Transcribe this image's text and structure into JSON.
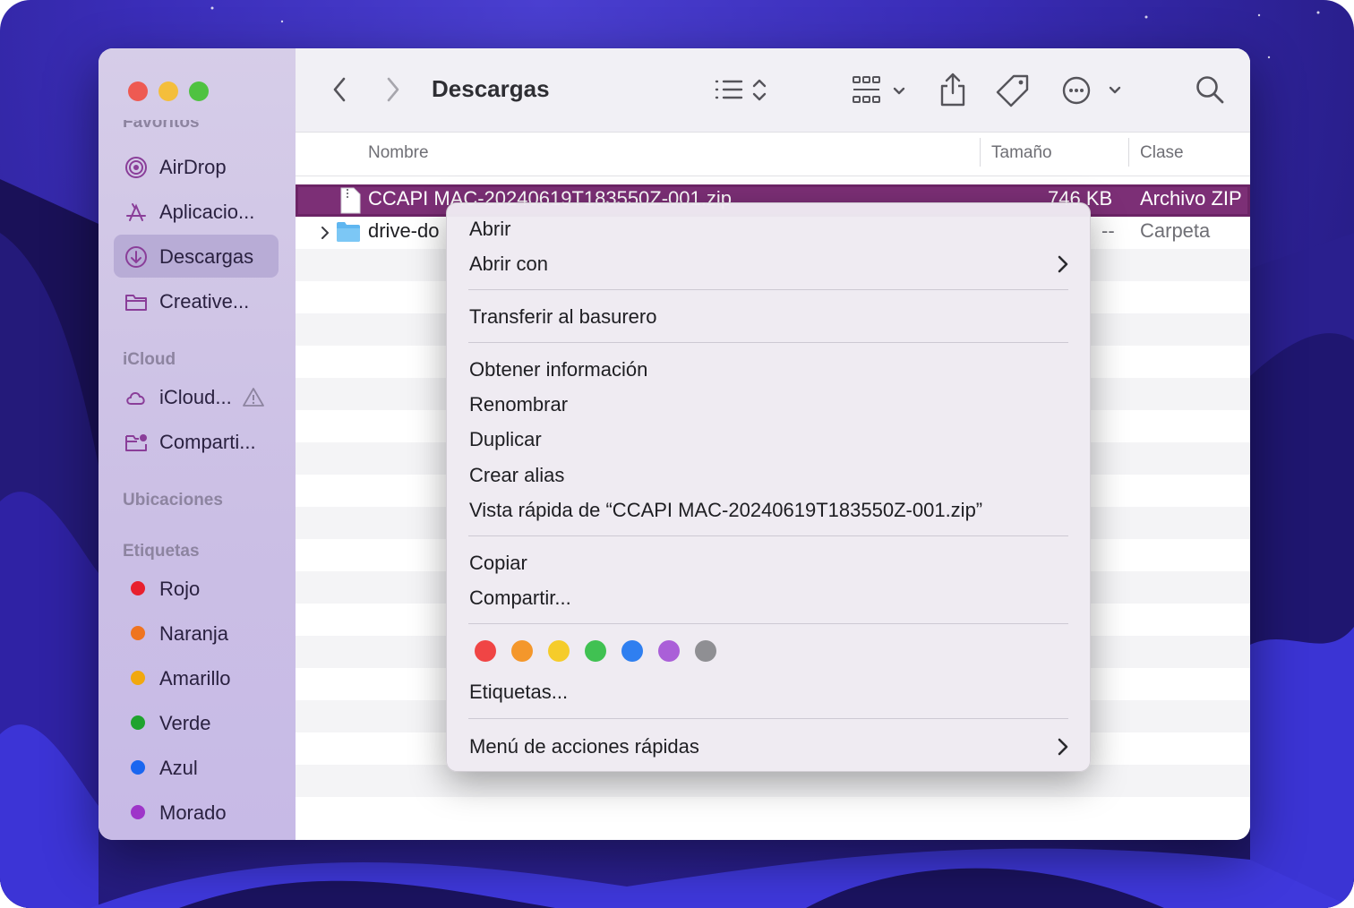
{
  "finder": {
    "title": "Descargas",
    "sidebar": {
      "favorites_title": "Favoritos",
      "favorites": [
        {
          "label": "AirDrop",
          "icon": "airdrop-icon"
        },
        {
          "label": "Aplicacio...",
          "icon": "applications-icon"
        },
        {
          "label": "Descargas",
          "icon": "downloads-icon",
          "selected": true
        },
        {
          "label": "Creative...",
          "icon": "folder-icon"
        }
      ],
      "icloud_title": "iCloud",
      "icloud": [
        {
          "label": "iCloud...",
          "icon": "icloud-icon",
          "warning_icon": "warning-icon"
        },
        {
          "label": "Comparti...",
          "icon": "shared-folder-icon"
        }
      ],
      "locations_title": "Ubicaciones",
      "tags_title": "Etiquetas",
      "tags": [
        {
          "label": "Rojo",
          "color": "#e8202e"
        },
        {
          "label": "Naranja",
          "color": "#ef7420"
        },
        {
          "label": "Amarillo",
          "color": "#f1a80f"
        },
        {
          "label": "Verde",
          "color": "#1fa32e"
        },
        {
          "label": "Azul",
          "color": "#1a66f0"
        },
        {
          "label": "Morado",
          "color": "#9e35c9"
        }
      ]
    },
    "columns": {
      "name": "Nombre",
      "size": "Tamaño",
      "kind": "Clase"
    },
    "files": [
      {
        "name": "CCAPI MAC-20240619T183550Z-001.zip",
        "size": "746 KB",
        "kind": "Archivo ZIP",
        "selected": true
      },
      {
        "name": "drive-do",
        "size": "--",
        "kind": "Carpeta"
      }
    ]
  },
  "context_menu": {
    "open": "Abrir",
    "open_with": "Abrir con",
    "trash": "Transferir al basurero",
    "get_info": "Obtener información",
    "rename": "Renombrar",
    "duplicate": "Duplicar",
    "make_alias": "Crear alias",
    "quick_look": "Vista rápida de “CCAPI MAC-20240619T183550Z-001.zip”",
    "copy": "Copiar",
    "share": "Compartir...",
    "tag_colors": [
      "#f04545",
      "#f4972b",
      "#f5cc2a",
      "#40c152",
      "#2f7ff0",
      "#aa5fd8",
      "#8f8f93"
    ],
    "tags": "Etiquetas...",
    "quick_actions": "Menú de acciones rápidas"
  },
  "colors": {
    "selection": "#7c2f76",
    "accent_window": "#3a2db8"
  }
}
